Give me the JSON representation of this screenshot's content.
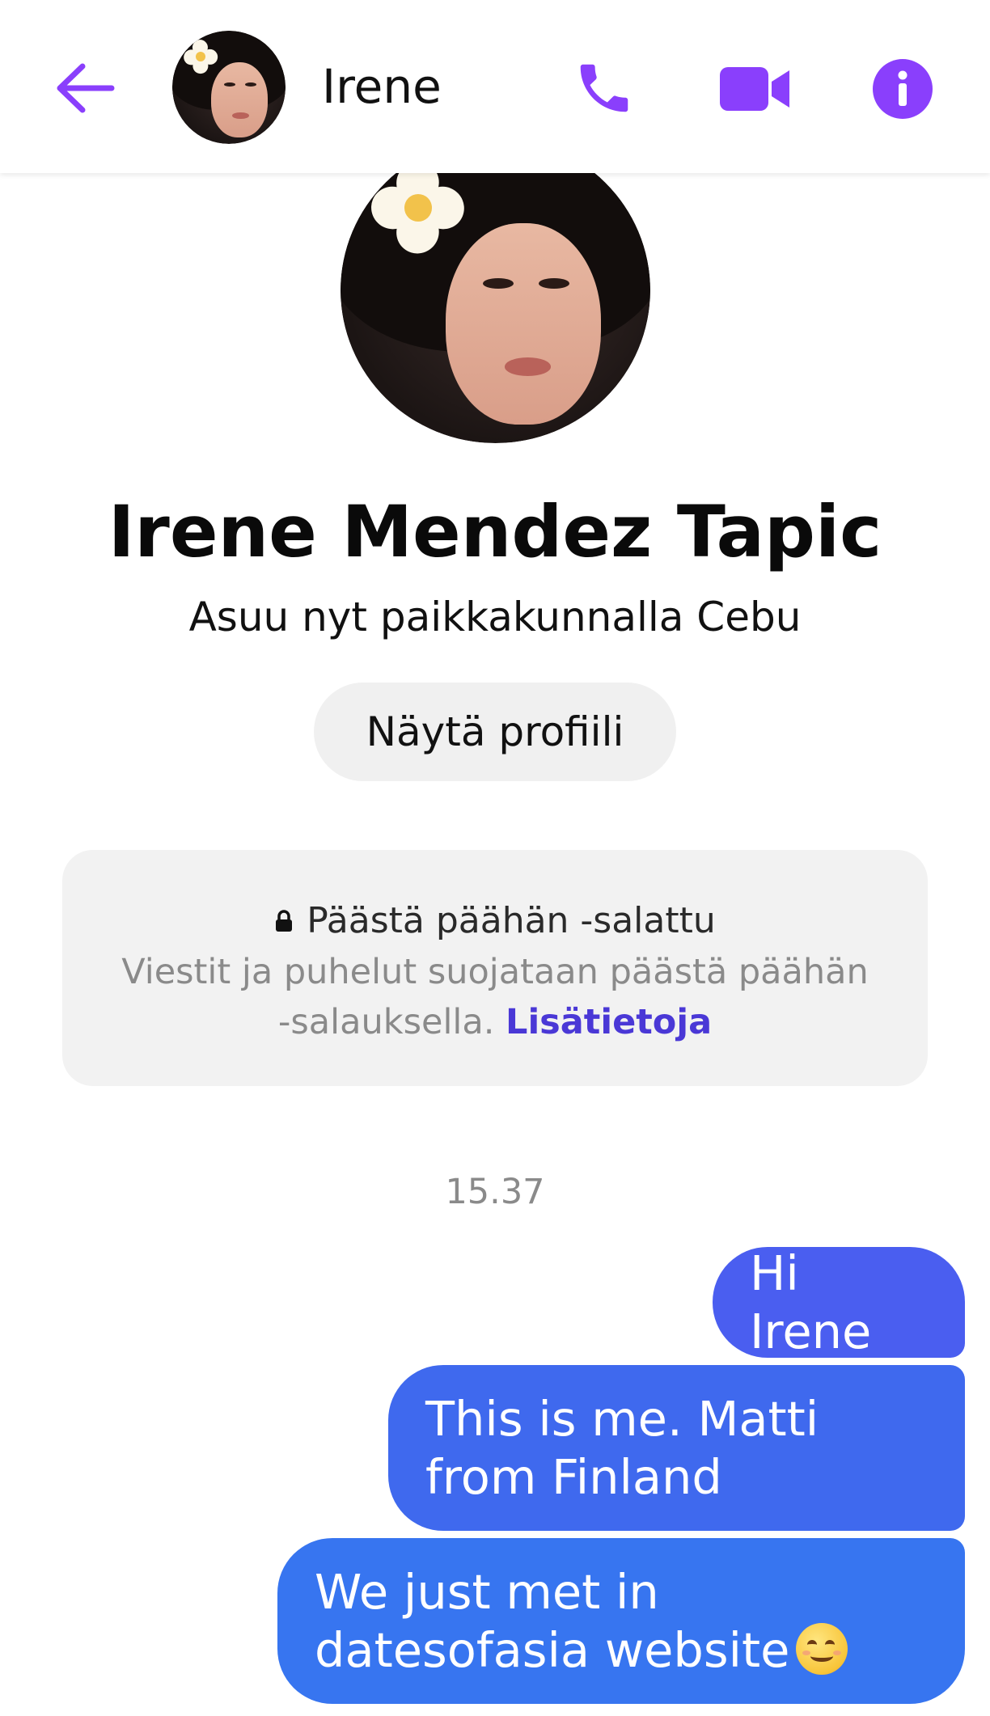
{
  "header": {
    "contact_name": "Irene",
    "back_icon": "arrow-left-icon",
    "call_icon": "phone-icon",
    "video_icon": "video-camera-icon",
    "info_icon": "info-icon"
  },
  "profile": {
    "full_name": "Irene Mendez Tapic",
    "subtitle": "Asuu nyt paikkakunnalla Cebu",
    "view_profile_label": "Näytä profiili"
  },
  "encryption": {
    "icon": "lock-icon",
    "title": "Päästä päähän -salattu",
    "body": "Viestit ja puhelut suojataan päästä päähän -salauksella.",
    "link_label": "Lisätietoja"
  },
  "conversation": {
    "timestamp": "15.37",
    "messages": [
      {
        "text": "Hi Irene",
        "sender": "me"
      },
      {
        "text": "This is me. Matti from Finland",
        "sender": "me"
      },
      {
        "text": "We just met in datesofasia website",
        "sender": "me",
        "emoji": "smiling-face-emoji"
      }
    ]
  },
  "colors": {
    "accent": "#8a3ffc",
    "link": "#4a38d6",
    "bubble_top": "#4a5ef0",
    "bubble_mid": "#3f69ee",
    "bubble_bottom": "#3775f0"
  }
}
